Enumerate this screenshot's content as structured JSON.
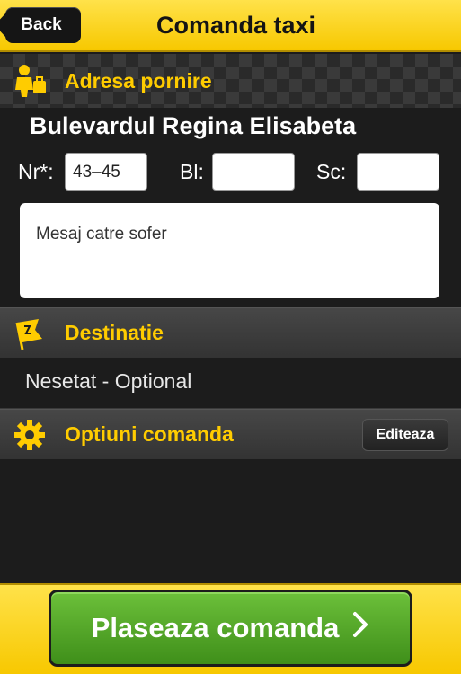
{
  "header": {
    "back_label": "Back",
    "title": "Comanda taxi"
  },
  "pickup": {
    "section_title": "Adresa pornire",
    "street": "Bulevardul Regina Elisabeta",
    "nr_label": "Nr*:",
    "nr_value": "43–45",
    "bl_label": "Bl:",
    "bl_value": "",
    "sc_label": "Sc:",
    "sc_value": "",
    "message_placeholder": "Mesaj catre sofer"
  },
  "destination": {
    "section_title": "Destinatie",
    "value": "Nesetat - Optional"
  },
  "options": {
    "section_title": "Optiuni comanda",
    "edit_label": "Editeaza"
  },
  "footer": {
    "place_order_label": "Plaseaza comanda"
  },
  "colors": {
    "accent": "#ffcc00",
    "header_bg": "#f7c800",
    "button_green": "#4fa524",
    "background": "#1c1c1c"
  },
  "icons": {
    "back": "back-arrow-icon",
    "pickup": "person-luggage-icon",
    "destination": "flag-icon",
    "options": "gear-icon",
    "submit": "chevron-right-icon"
  }
}
